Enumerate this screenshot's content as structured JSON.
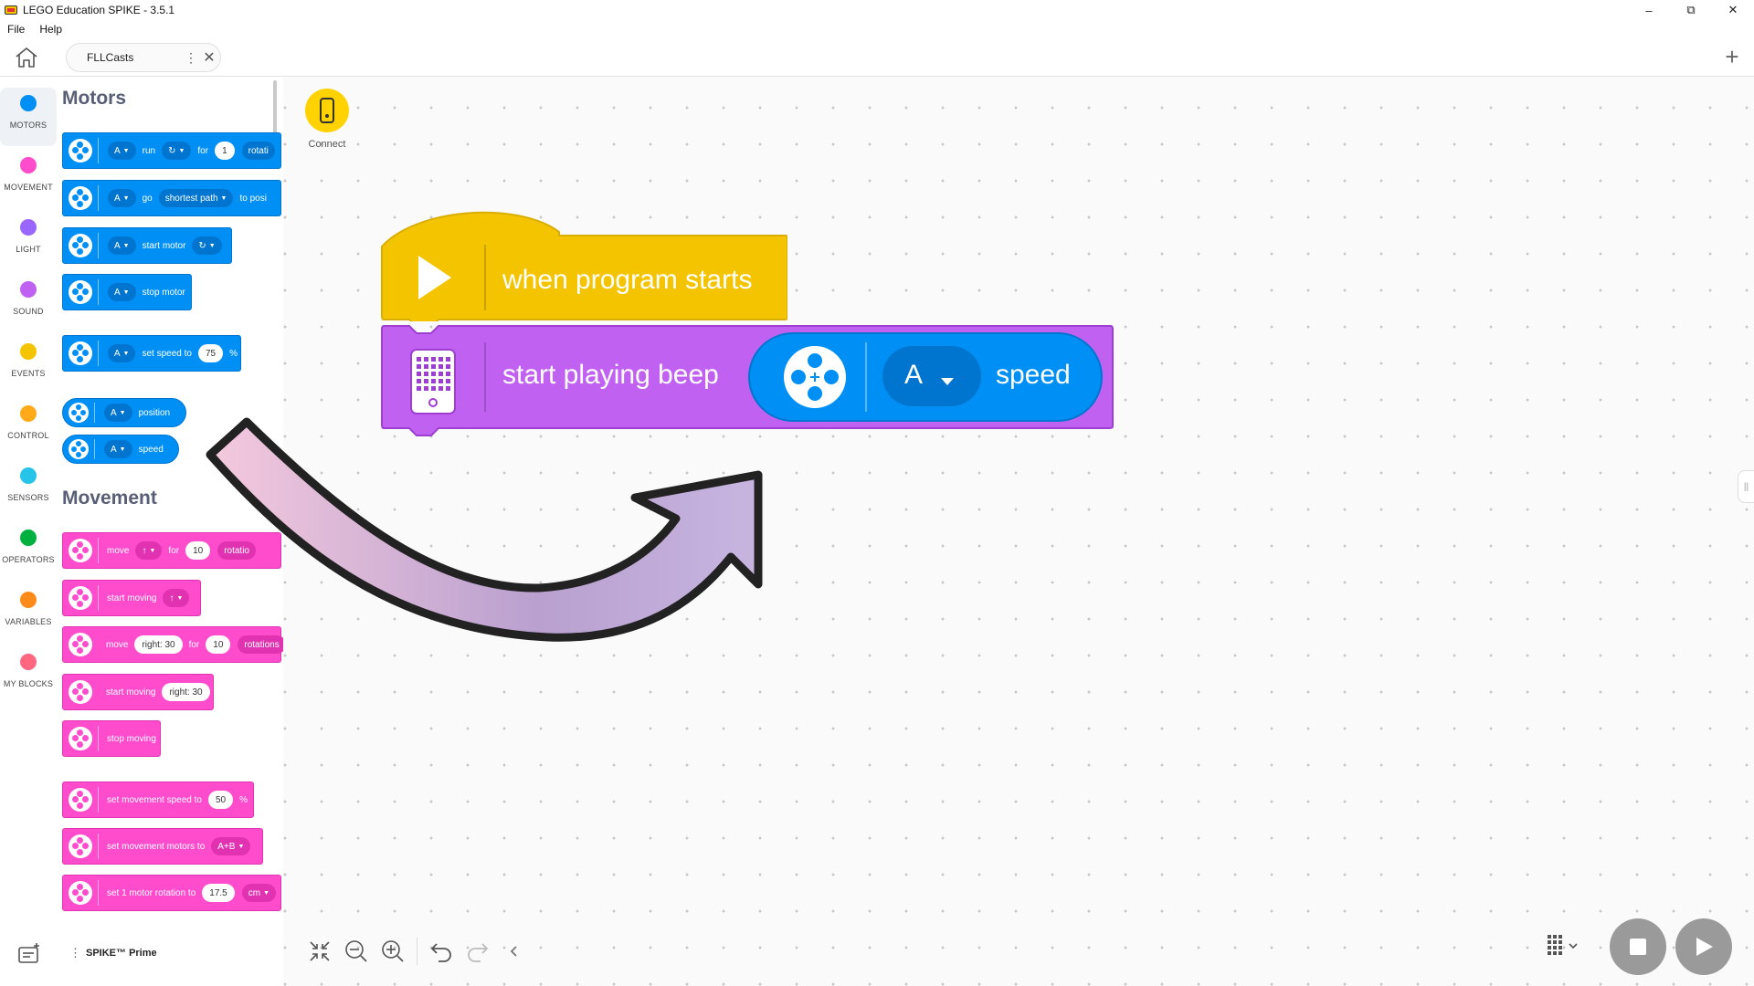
{
  "window": {
    "title": "LEGO Education SPIKE - 3.5.1",
    "minimize": "–",
    "maximize": "⧉",
    "close": "✕"
  },
  "menu": {
    "file": "File",
    "help": "Help"
  },
  "tabs": {
    "project_name": "FLLCasts",
    "kebab": "⋮",
    "close": "✕",
    "new_tab": "+"
  },
  "categories": [
    {
      "label": "MOTORS",
      "color": "#0090f5"
    },
    {
      "label": "MOVEMENT",
      "color": "#ff4ccd"
    },
    {
      "label": "LIGHT",
      "color": "#9966ff"
    },
    {
      "label": "SOUND",
      "color": "#c061f1"
    },
    {
      "label": "EVENTS",
      "color": "#f5c400"
    },
    {
      "label": "CONTROL",
      "color": "#ffab19"
    },
    {
      "label": "SENSORS",
      "color": "#25c4e8"
    },
    {
      "label": "OPERATORS",
      "color": "#00b140"
    },
    {
      "label": "VARIABLES",
      "color": "#ff8c1a"
    },
    {
      "label": "MY BLOCKS",
      "color": "#ff6680"
    }
  ],
  "palette": {
    "motors_title": "Motors",
    "movement_title": "Movement",
    "motors": {
      "run": {
        "port": "A",
        "word1": "run",
        "word2": "for",
        "value": "1",
        "unit": "rotati"
      },
      "go": {
        "port": "A",
        "word1": "go",
        "mode": "shortest path",
        "word2": "to posi"
      },
      "start": {
        "port": "A",
        "word1": "start motor"
      },
      "stop": {
        "port": "A",
        "word1": "stop motor"
      },
      "set_speed": {
        "port": "A",
        "word1": "set speed to",
        "value": "75",
        "unit": "%"
      },
      "position": {
        "port": "A",
        "word1": "position"
      },
      "speed": {
        "port": "A",
        "word1": "speed"
      }
    },
    "movement": {
      "move": {
        "word1": "move",
        "word2": "for",
        "value": "10",
        "unit": "rotatio"
      },
      "start_moving": {
        "word1": "start moving"
      },
      "move_steer": {
        "word1": "move",
        "steer": "right: 30",
        "word2": "for",
        "value": "10",
        "unit": "rotations"
      },
      "start_moving_steer": {
        "word1": "start moving",
        "steer": "right: 30"
      },
      "stop_moving": {
        "word1": "stop moving"
      },
      "set_speed": {
        "word1": "set movement speed to",
        "value": "50",
        "unit": "%"
      },
      "set_motors": {
        "word1": "set movement motors to",
        "value": "A+B"
      },
      "set_rotation": {
        "word1": "set 1 motor rotation to",
        "value": "17.5",
        "unit": "cm"
      }
    }
  },
  "canvas": {
    "connect_label": "Connect",
    "hat_text": "when program starts",
    "beep_text": "start playing beep",
    "reporter_port": "A",
    "reporter_text": "speed"
  },
  "bottom": {
    "device_name": "SPIKE™ Prime",
    "kebab": "⋮"
  },
  "side_handle": "||"
}
